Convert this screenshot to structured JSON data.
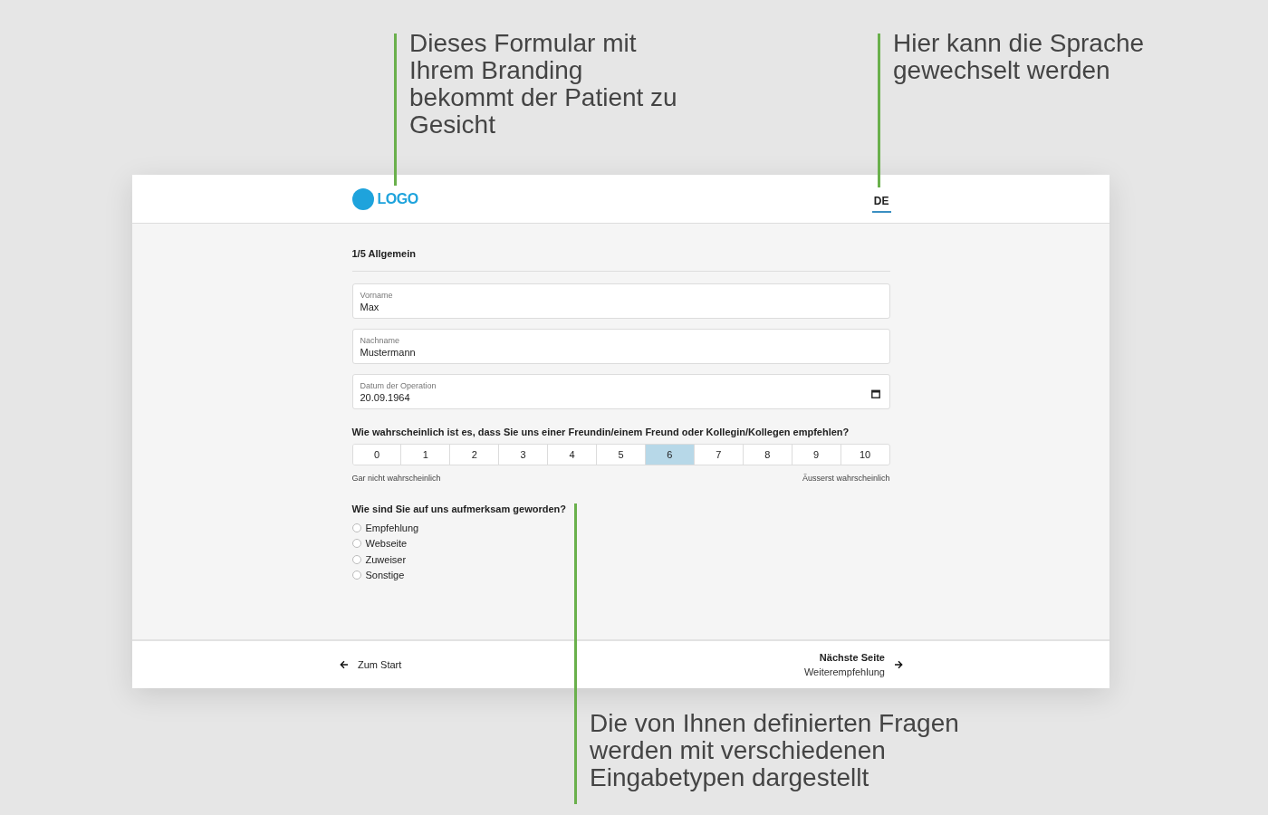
{
  "annotations": [
    {
      "text": "Dieses Formular mit Ihrem Branding bekommt der Patient zu Gesicht",
      "kind": "top-left"
    },
    {
      "text": "Hier kann die Sprache gewechselt werden",
      "kind": "top-right"
    },
    {
      "text": "Die von Ihnen definierten Fragen werden mit verschiedenen Eingabetypen dargestellt",
      "kind": "bottom"
    }
  ],
  "header": {
    "logo": "LOGO",
    "language": {
      "label": "DE",
      "selected": true
    }
  },
  "form": {
    "step_title": "1/5 Allgemein",
    "fields": [
      {
        "label": "Vorname",
        "value": "Max",
        "kind": "text"
      },
      {
        "label": "Nachname",
        "value": "Mustermann",
        "kind": "text"
      },
      {
        "label": "Datum der Operation",
        "value": "20.09.1964",
        "kind": "date"
      }
    ],
    "scale_question": {
      "question": "Wie wahrscheinlich ist es, dass Sie uns einer Freundin/einem Freund oder Kollegin/Kollegen empfehlen?",
      "options": [
        {
          "label": "0",
          "selected": false
        },
        {
          "label": "1",
          "selected": false
        },
        {
          "label": "2",
          "selected": false
        },
        {
          "label": "3",
          "selected": false
        },
        {
          "label": "4",
          "selected": false
        },
        {
          "label": "5",
          "selected": false
        },
        {
          "label": "6",
          "selected": true
        },
        {
          "label": "7",
          "selected": false
        },
        {
          "label": "8",
          "selected": false
        },
        {
          "label": "9",
          "selected": false
        },
        {
          "label": "10",
          "selected": false
        }
      ],
      "min_label": "Gar nicht wahrscheinlich",
      "max_label": "Äusserst wahrscheinlich"
    },
    "radio_question": {
      "question": "Wie sind Sie auf uns aufmerksam geworden?",
      "options": [
        {
          "label": "Empfehlung",
          "selected": false
        },
        {
          "label": "Webseite",
          "selected": false
        },
        {
          "label": "Zuweiser",
          "selected": false
        },
        {
          "label": "Sonstige",
          "selected": false
        }
      ]
    }
  },
  "footer": {
    "back": "Zum Start",
    "next_title": "Nächste Seite",
    "next_subtitle": "Weiterempfehlung"
  }
}
